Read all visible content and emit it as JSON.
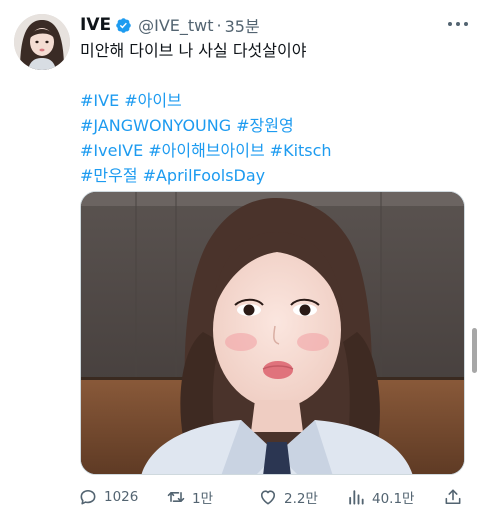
{
  "tweet": {
    "author": {
      "display_name": "IVE",
      "handle": "@IVE_twt",
      "verified": true,
      "avatar_icon": "profile-photo-icon"
    },
    "separator": "·",
    "timestamp": "35분",
    "text": "미안해 다이브 나 사실 다섯살이야",
    "hashtag_lines": [
      [
        "#IVE",
        "#아이브"
      ],
      [
        "#JANGWONYOUNG",
        "#장원영"
      ],
      [
        "#IveIVE",
        "#아이해브아이브",
        "#Kitsch"
      ],
      [
        "#만우절",
        "#AprilFoolsDay"
      ]
    ],
    "media": {
      "icon": "selfie-photo"
    },
    "actions": {
      "reply_count": "1026",
      "retweet_count": "1만",
      "like_count": "2.2만",
      "view_count": "40.1만"
    }
  },
  "colors": {
    "link": "#1d9bf0",
    "secondary_text": "#536471",
    "primary_text": "#0f1419",
    "verified_badge": "#1d9bf0"
  }
}
